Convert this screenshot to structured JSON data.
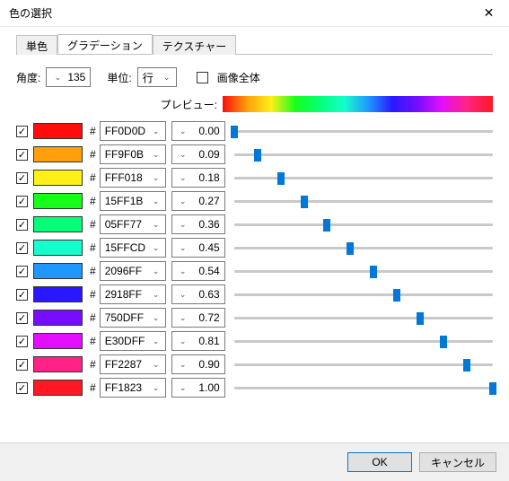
{
  "title": "色の選択",
  "close_glyph": "✕",
  "tabs": {
    "solid": "単色",
    "gradient": "グラデーション",
    "texture": "テクスチャー"
  },
  "angle": {
    "label": "角度:",
    "value": "135"
  },
  "unit": {
    "label": "単位:",
    "value": "行"
  },
  "whole_image": {
    "label": "画像全体"
  },
  "preview_label": "プレビュー:",
  "hash": "#",
  "chevron_glyph": "⌄",
  "stops": [
    {
      "hex": "FF0D0D",
      "pos": "0.00",
      "pos_num": 0.0,
      "color": "#FF0D0D"
    },
    {
      "hex": "FF9F0B",
      "pos": "0.09",
      "pos_num": 0.09,
      "color": "#FF9F0B"
    },
    {
      "hex": "FFF018",
      "pos": "0.18",
      "pos_num": 0.18,
      "color": "#FFF018"
    },
    {
      "hex": "15FF1B",
      "pos": "0.27",
      "pos_num": 0.27,
      "color": "#15FF1B"
    },
    {
      "hex": "05FF77",
      "pos": "0.36",
      "pos_num": 0.36,
      "color": "#05FF77"
    },
    {
      "hex": "15FFCD",
      "pos": "0.45",
      "pos_num": 0.45,
      "color": "#15FFCD"
    },
    {
      "hex": "2096FF",
      "pos": "0.54",
      "pos_num": 0.54,
      "color": "#2096FF"
    },
    {
      "hex": "2918FF",
      "pos": "0.63",
      "pos_num": 0.63,
      "color": "#2918FF"
    },
    {
      "hex": "750DFF",
      "pos": "0.72",
      "pos_num": 0.72,
      "color": "#750DFF"
    },
    {
      "hex": "E30DFF",
      "pos": "0.81",
      "pos_num": 0.81,
      "color": "#E30DFF"
    },
    {
      "hex": "FF2287",
      "pos": "0.90",
      "pos_num": 0.9,
      "color": "#FF2287"
    },
    {
      "hex": "FF1823",
      "pos": "1.00",
      "pos_num": 1.0,
      "color": "#FF1823"
    }
  ],
  "buttons": {
    "ok": "OK",
    "cancel": "キャンセル"
  },
  "check_glyph": "✓"
}
